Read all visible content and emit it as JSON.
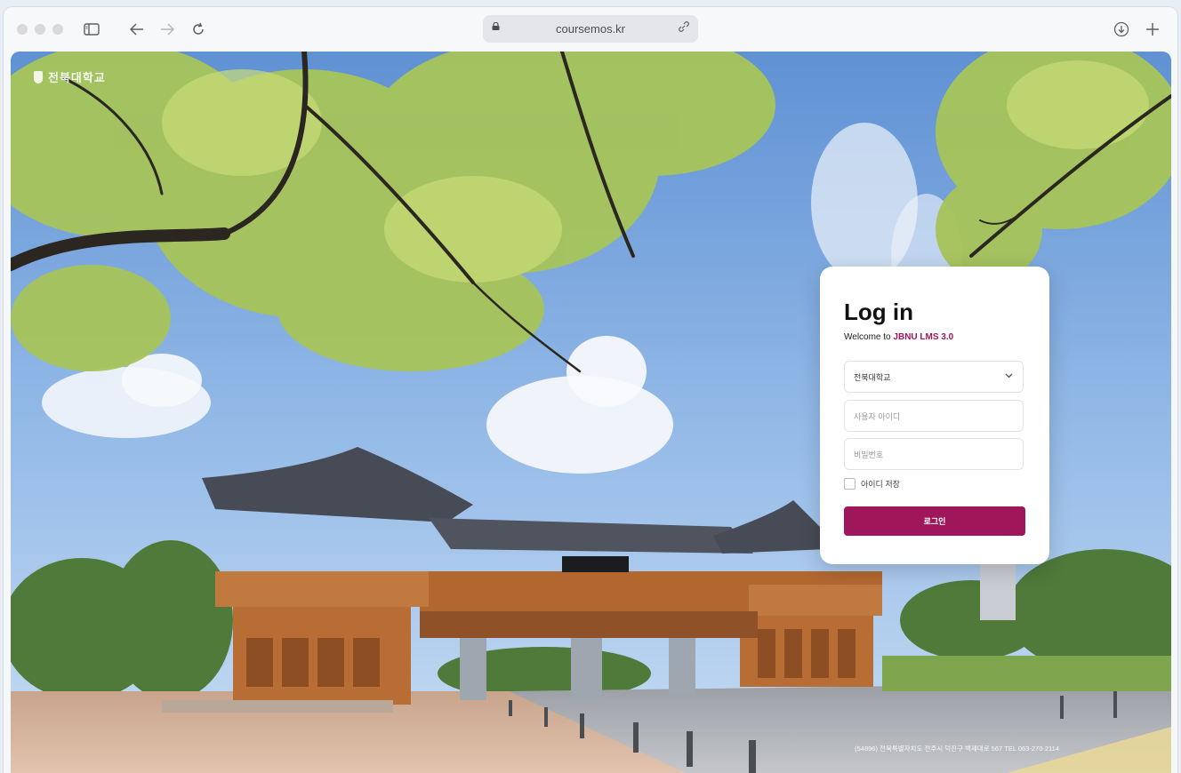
{
  "browser": {
    "url": "coursemos.kr",
    "icons": [
      "sidebar-icon",
      "back-arrow-icon",
      "forward-arrow-icon",
      "reload-icon",
      "lock-icon",
      "link-icon",
      "download-icon",
      "plus-icon"
    ]
  },
  "site": {
    "logo_text": "전북대학교",
    "footer_address": "(54896) 전북특별자치도 전주시 덕진구 백제대로 567 TEL 063-270-2114"
  },
  "login": {
    "title": "Log in",
    "welcome_prefix": "Welcome to",
    "welcome_brand": "JBNU LMS 3.0",
    "school_select": "전북대학교",
    "username_placeholder": "사용자 아이디",
    "password_placeholder": "비밀번호",
    "remember_label": "아이디 저장",
    "login_button": "로그인"
  },
  "colors": {
    "brand": "#a0165a",
    "sky": "#8db4e4"
  }
}
